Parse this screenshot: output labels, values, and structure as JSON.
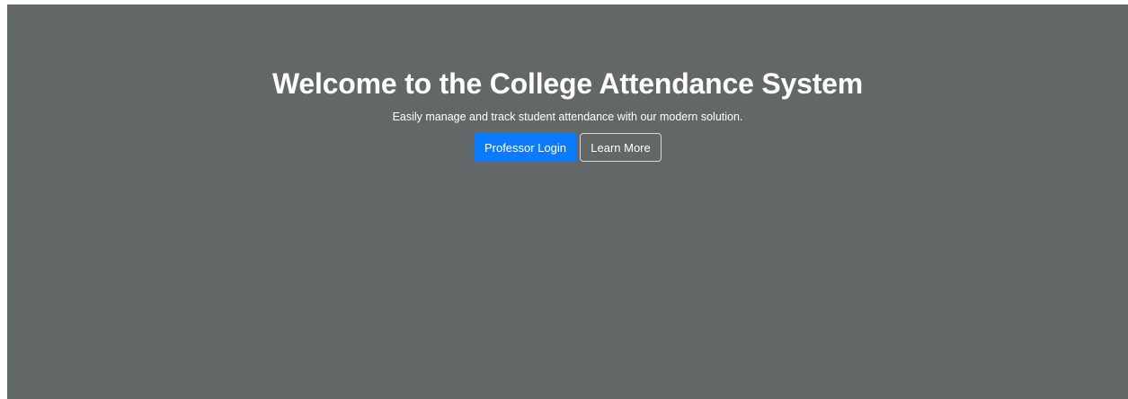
{
  "hero": {
    "title": "Welcome to the College Attendance System",
    "subtitle": "Easily manage and track student attendance with our modern solution.",
    "primary_button_label": "Professor Login",
    "secondary_button_label": "Learn More"
  },
  "colors": {
    "hero_background": "#626767",
    "primary_button": "#0a7bff",
    "text": "#ffffff",
    "outline_border": "#d6d8d8"
  }
}
